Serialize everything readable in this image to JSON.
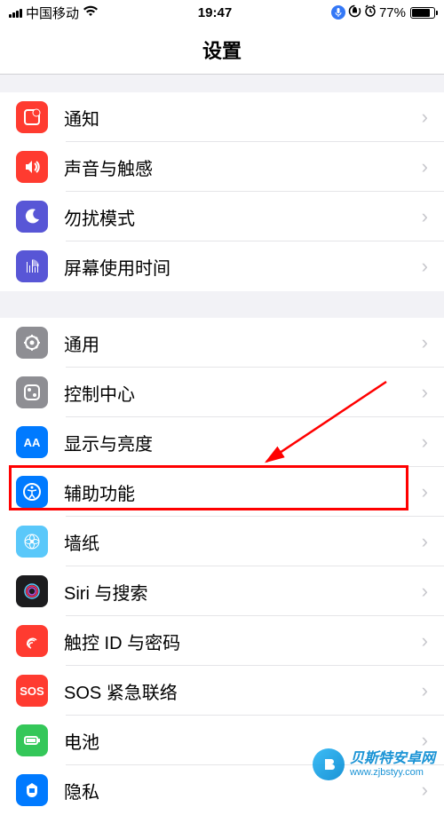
{
  "status": {
    "carrier": "中国移动",
    "time": "19:47",
    "battery_pct": "77%"
  },
  "header": {
    "title": "设置"
  },
  "group1": {
    "notifications": "通知",
    "sounds": "声音与触感",
    "dnd": "勿扰模式",
    "screentime": "屏幕使用时间"
  },
  "group2": {
    "general": "通用",
    "control_center": "控制中心",
    "display": "显示与亮度",
    "accessibility": "辅助功能",
    "wallpaper": "墙纸",
    "siri": "Siri 与搜索",
    "touchid": "触控 ID 与密码",
    "sos": "SOS 紧急联络",
    "battery": "电池",
    "privacy": "隐私"
  },
  "sos_icon_text": "SOS",
  "watermark": {
    "name": "贝斯特安卓网",
    "url": "www.zjbstyy.com"
  }
}
